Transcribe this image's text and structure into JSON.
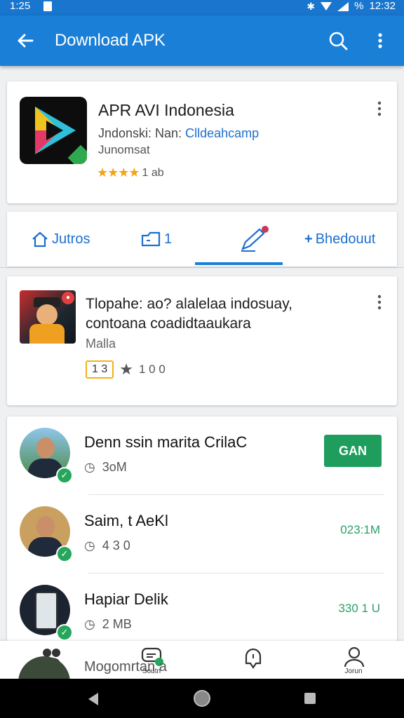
{
  "status_bar": {
    "time": "1:25",
    "clock": "12:32",
    "battery": "%"
  },
  "app_bar": {
    "title": "Download APK"
  },
  "app_card": {
    "name": "APR AVI Indonesia",
    "subtitle_prefix": "Jndonski: Nan: ",
    "subtitle_link": "Clldeahcamp",
    "subtitle2": "Junomsat",
    "stars": "★★★★",
    "rating_text": "1 ab"
  },
  "tabs": [
    {
      "label": "Jutros",
      "icon": "home-icon"
    },
    {
      "label": "1",
      "icon": "folder-icon"
    },
    {
      "label": "",
      "icon": "edit-pen-icon"
    },
    {
      "label": "Bhedouut",
      "icon": "add-icon"
    }
  ],
  "promo_card": {
    "line1": "Tlopahe: ao?  alalelaa indosuay,",
    "line2": "contoana coadidtaaukara",
    "line3": "Malla",
    "tag": "1 3",
    "rating": "1 0 0"
  },
  "list_items": [
    {
      "title": "Denn ssin marita CrilaC",
      "size": "3oM",
      "action": "GAN",
      "type": "button"
    },
    {
      "title": "Saim, t AeKl",
      "size": "4 3 0",
      "action": "023:1M",
      "type": "text"
    },
    {
      "title": "Hapiar Delik",
      "size": "2 MB",
      "action": "330 1 U",
      "type": "text"
    }
  ],
  "peek_text": "Mogomrtan a",
  "bottom_nav": [
    {
      "label": "",
      "icon": "community-icon"
    },
    {
      "label": "Soutn",
      "icon": "chat-icon"
    },
    {
      "label": "",
      "icon": "notification-bell-icon"
    },
    {
      "label": "Jorun",
      "icon": "profile-icon"
    }
  ],
  "colors": {
    "primary": "#1a7fd6",
    "accent_green": "#1f9d5d",
    "star": "#f2a416"
  }
}
